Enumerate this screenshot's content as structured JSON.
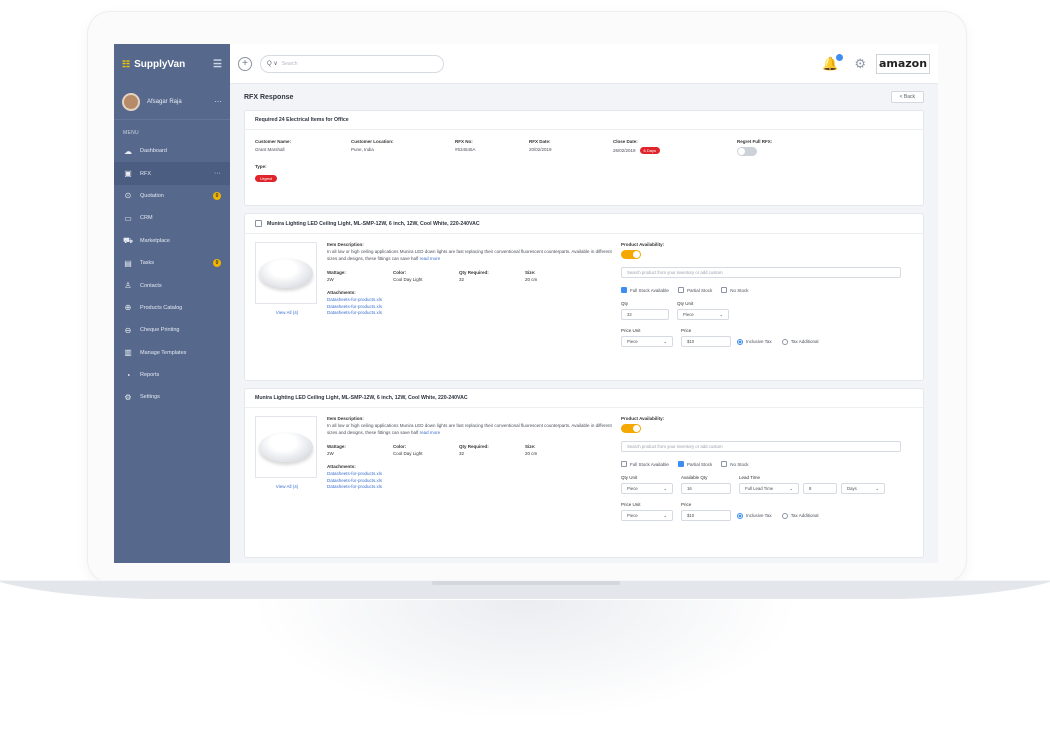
{
  "brand": {
    "name": "SupplyVan",
    "partner_logo": "amazon"
  },
  "user": {
    "name": "Afsagar Raja"
  },
  "sidebar": {
    "menu_heading": "MENU",
    "items": [
      {
        "label": "Dashboard",
        "icon": "cloud-icon"
      },
      {
        "label": "RFX",
        "icon": "rfx-icon",
        "active": true
      },
      {
        "label": "Quotation",
        "icon": "dollar-icon",
        "badge": "0"
      },
      {
        "label": "CRM",
        "icon": "crm-icon"
      },
      {
        "label": "Marketplace",
        "icon": "cart-icon"
      },
      {
        "label": "Tasks",
        "icon": "clipboard-icon",
        "badge": "0"
      },
      {
        "label": "Contacts",
        "icon": "contacts-icon"
      },
      {
        "label": "Products Catalog",
        "icon": "catalog-icon"
      },
      {
        "label": "Cheque Printing",
        "icon": "print-icon"
      },
      {
        "label": "Manage Templates",
        "icon": "template-icon"
      },
      {
        "label": "Reports",
        "icon": "reports-icon"
      },
      {
        "label": "Settings",
        "icon": "gear-icon"
      }
    ]
  },
  "topbar": {
    "search_prefix": "Q ∨",
    "search_placeholder": "Search"
  },
  "page": {
    "title": "RFX Response",
    "back_label": "< Back"
  },
  "rfx": {
    "title": "Required 24 Electrical Items for Office",
    "customer_name_label": "Customer Name:",
    "customer_name": "Grant Marshall",
    "customer_location_label": "Customer Location:",
    "customer_location": "Pune, India",
    "rfx_no_label": "RFX No:",
    "rfx_no": "#534545A",
    "rfx_date_label": "RFX Date:",
    "rfx_date": "20/02/2019",
    "close_date_label": "Close Date:",
    "close_date": "26/02/2019",
    "days_left": "6 Days",
    "regret_label": "Regret Full RFX:",
    "type_label": "Type:",
    "type": "Urgent"
  },
  "items": [
    {
      "title": "Munira Lighting LED Ceiling Light, ML-SMP-12W, 6 inch, 12W, Cool White, 220-240VAC",
      "desc_label": "Item Description:",
      "desc": "In all low or high ceiling applications Munira LED down lights are fast replacing their conventional fluorescent counterparts. Available in different sizes and designs, these fittings can save half",
      "read_more": "read more",
      "wattage_label": "Wattage:",
      "wattage": "2W",
      "color_label": "Color:",
      "color": "Cool Day Light",
      "qty_label": "Qty Required:",
      "qty": "32",
      "size_label": "Size:",
      "size": "20 cm",
      "attachments_label": "Attachments:",
      "attachments": [
        "Datasheets-for-products.xls",
        "Datasheets-for-products.xls",
        "Datasheets-for-products.xls"
      ],
      "view_all": "View All (4)",
      "availability_label": "Product Availability:",
      "search_placeholder": "Search product from your inventory or add custom",
      "stock_options": [
        "Full Stock Available",
        "Partial Stock",
        "No Stock"
      ],
      "qty_field_label": "Qty",
      "qty_value": "32",
      "qty_unit_label": "Qty Unit",
      "qty_unit": "Piece",
      "price_unit_label": "Price Unit",
      "price_unit": "Piece",
      "price_label": "Price",
      "price": "$10",
      "tax_options": [
        "Inclusive Tax",
        "Tax Additional"
      ]
    },
    {
      "title": "Munira Lighting LED Ceiling Light, ML-SMP-12W, 6 inch, 12W, Cool White, 220-240VAC",
      "desc_label": "Item Description:",
      "desc": "In all low or high ceiling applications Munira LED down lights are fast replacing their conventional fluorescent counterparts. Available in different sizes and designs, these fittings can save half",
      "read_more": "read more",
      "wattage_label": "Wattage:",
      "wattage": "2W",
      "color_label": "Color:",
      "color": "Cool Day Light",
      "qty_label": "Qty Required:",
      "qty": "32",
      "size_label": "Size:",
      "size": "20 cm",
      "attachments_label": "Attachments:",
      "attachments": [
        "Datasheets-for-products.xls",
        "Datasheets-for-products.xls",
        "Datasheets-for-products.xls"
      ],
      "view_all": "View All (4)",
      "availability_label": "Product Availability:",
      "search_placeholder": "Search product from your inventory or add custom",
      "stock_options": [
        "Full Stock Available",
        "Partial Stock",
        "No Stock"
      ],
      "qty_unit_label": "Qty Unit",
      "qty_unit": "Piece",
      "available_qty_label": "Available Qty",
      "available_qty": "16",
      "lead_time_label": "Lead Time",
      "lead_time_type": "Full Lead Time",
      "lead_time_value": "8",
      "lead_time_unit": "Days",
      "price_unit_label": "Price Unit",
      "price_unit": "Piece",
      "price_label": "Price",
      "price": "$10",
      "tax_options": [
        "Inclusive Tax",
        "Tax Additional"
      ]
    }
  ],
  "colors": {
    "sidebar": "#56698d",
    "accent": "#f5a800",
    "badge_red": "#e0242b",
    "link": "#3a6fd0"
  }
}
